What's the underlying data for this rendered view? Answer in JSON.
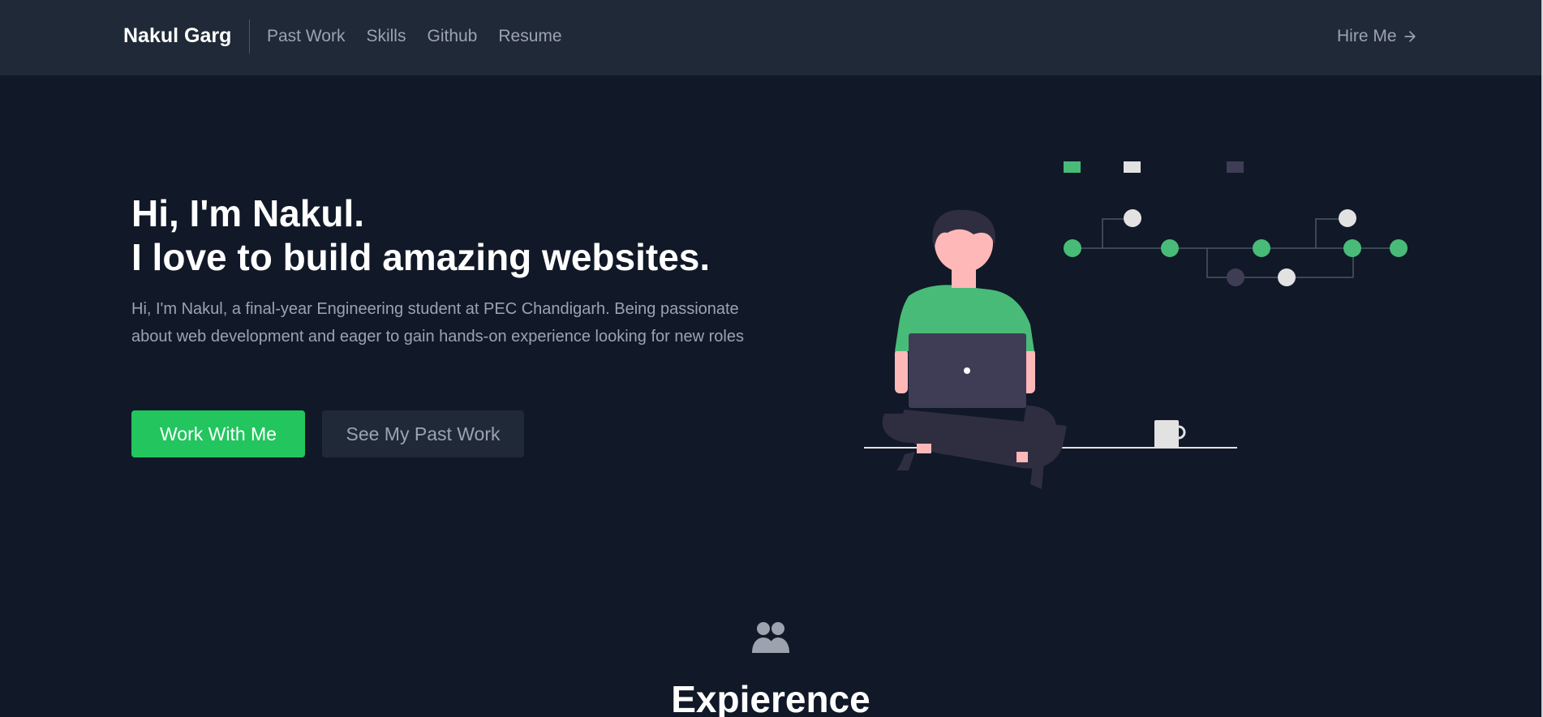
{
  "nav": {
    "brand": "Nakul Garg",
    "links": [
      "Past Work",
      "Skills",
      "Github",
      "Resume"
    ],
    "cta": "Hire Me"
  },
  "hero": {
    "title_line1": "Hi, I'm Nakul.",
    "title_line2": "I love to build amazing websites.",
    "description": "Hi, I'm Nakul, a final-year Engineering student at PEC Chandigarh. Being passionate about web development and eager to gain hands-on experience looking for new roles",
    "primary_button": "Work With Me",
    "secondary_button": "See My Past Work"
  },
  "experience": {
    "icon": "users-icon",
    "title": "Expierence"
  },
  "colors": {
    "background": "#111827",
    "navbar": "#1f2937",
    "accent": "#22c55e",
    "text_muted": "#9ca3af",
    "heading": "#ffffff"
  }
}
